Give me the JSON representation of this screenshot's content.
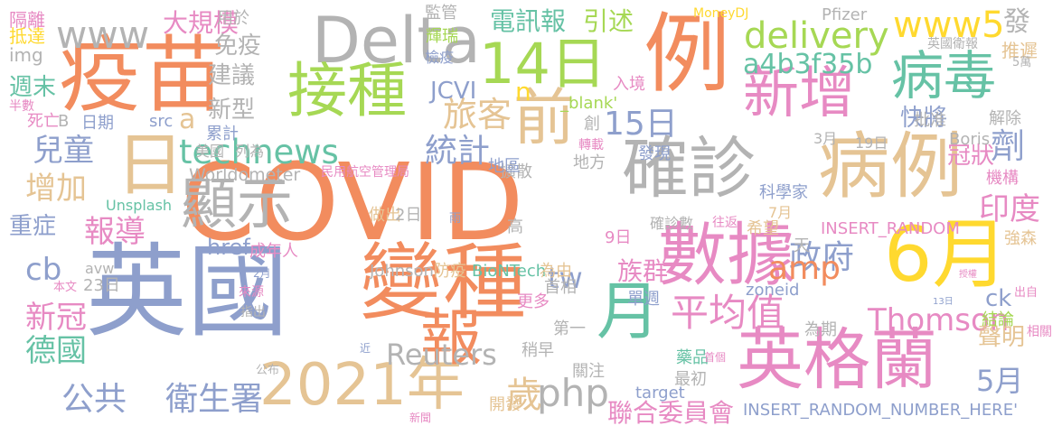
{
  "words": [
    {
      "text": "COVID",
      "color": "#f28c5e"
    },
    {
      "text": "英國",
      "color": "#8e9fcc"
    },
    {
      "text": "疫苗",
      "color": "#f28c5e"
    },
    {
      "text": "例",
      "color": "#f28c5e"
    },
    {
      "text": "變種",
      "color": "#f28c5e"
    },
    {
      "text": "英格蘭",
      "color": "#e78ac3"
    },
    {
      "text": "2021年",
      "color": "#e5c494"
    },
    {
      "text": "數據",
      "color": "#e78ac3"
    },
    {
      "text": "6月",
      "color": "#ffd92f"
    },
    {
      "text": "病例",
      "color": "#e5c494"
    },
    {
      "text": "確診",
      "color": "#b3b3b3"
    },
    {
      "text": "Delta",
      "color": "#b3b3b3"
    },
    {
      "text": "接種",
      "color": "#a6d854"
    },
    {
      "text": "14日",
      "color": "#a6d854"
    },
    {
      "text": "日",
      "color": "#e5c494"
    },
    {
      "text": "顯示",
      "color": "#b3b3b3"
    },
    {
      "text": "新增",
      "color": "#e78ac3"
    },
    {
      "text": "病毒",
      "color": "#66c2a5"
    },
    {
      "text": "前",
      "color": "#e5c494"
    },
    {
      "text": "月",
      "color": "#66c2a5"
    },
    {
      "text": "報",
      "color": "#f28c5e"
    },
    {
      "text": "www",
      "color": "#b3b3b3"
    },
    {
      "text": "www5",
      "color": "#ffd92f"
    },
    {
      "text": "delivery",
      "color": "#a6d854"
    },
    {
      "text": "technews",
      "color": "#66c2a5"
    },
    {
      "text": "公共",
      "color": "#8e9fcc"
    },
    {
      "text": "衛生署",
      "color": "#8e9fcc"
    },
    {
      "text": "php",
      "color": "#b3b3b3"
    },
    {
      "text": "平均值",
      "color": "#e78ac3"
    },
    {
      "text": "政府",
      "color": "#8e9fcc"
    },
    {
      "text": "Thomson",
      "color": "#e78ac3"
    },
    {
      "text": "amp",
      "color": "#f28c5e"
    },
    {
      "text": "Reuters",
      "color": "#b3b3b3"
    },
    {
      "text": "旅客",
      "color": "#e5c494"
    },
    {
      "text": "統計",
      "color": "#8e9fcc"
    },
    {
      "text": "15日",
      "color": "#8e9fcc"
    },
    {
      "text": "兒童",
      "color": "#8e9fcc"
    },
    {
      "text": "增加",
      "color": "#e5c494"
    },
    {
      "text": "報導",
      "color": "#e78ac3"
    },
    {
      "text": "新冠",
      "color": "#e78ac3"
    },
    {
      "text": "德國",
      "color": "#66c2a5"
    },
    {
      "text": "cb",
      "color": "#8e9fcc"
    },
    {
      "text": "印度",
      "color": "#e78ac3"
    },
    {
      "text": "劑",
      "color": "#8e9fcc"
    },
    {
      "text": "5月",
      "color": "#8e9fcc"
    },
    {
      "text": "tw",
      "color": "#8e9fcc"
    },
    {
      "text": "歲",
      "color": "#e5c494"
    },
    {
      "text": "a4b3f35b",
      "color": "#66c2a5"
    },
    {
      "text": "電訊報",
      "color": "#66c2a5"
    },
    {
      "text": "引述",
      "color": "#a6d854"
    },
    {
      "text": "大規模",
      "color": "#e78ac3"
    },
    {
      "text": "免疫",
      "color": "#b3b3b3"
    },
    {
      "text": "建議",
      "color": "#b3b3b3"
    },
    {
      "text": "新型",
      "color": "#b3b3b3"
    },
    {
      "text": "週末",
      "color": "#66c2a5"
    },
    {
      "text": "JCVI",
      "color": "#8e9fcc"
    },
    {
      "text": "族群",
      "color": "#e78ac3"
    },
    {
      "text": "ck",
      "color": "#8e9fcc"
    },
    {
      "text": "聯合委員會",
      "color": "#e78ac3"
    },
    {
      "text": "重症",
      "color": "#8e9fcc"
    },
    {
      "text": "href",
      "color": "#8e9fcc"
    },
    {
      "text": "發",
      "color": "#b3b3b3"
    },
    {
      "text": "快將",
      "color": "#8e9fcc"
    },
    {
      "text": "冠狀",
      "color": "#e78ac3"
    },
    {
      "text": "聲明",
      "color": "#e5c494"
    },
    {
      "text": "a",
      "color": "#e5c494"
    },
    {
      "text": "n",
      "color": "#ffd92f"
    },
    {
      "text": "隔離",
      "color": "#e78ac3"
    },
    {
      "text": "抵達",
      "color": "#ffd92f"
    },
    {
      "text": "img",
      "color": "#b3b3b3"
    },
    {
      "text": "用於",
      "color": "#b3b3b3"
    },
    {
      "text": "監管",
      "color": "#b3b3b3"
    },
    {
      "text": "輝瑞",
      "color": "#a6d854"
    },
    {
      "text": "檢疫",
      "color": "#8e9fcc"
    },
    {
      "text": "MoneyDJ",
      "color": "#ffd92f"
    },
    {
      "text": "Pfizer",
      "color": "#b3b3b3"
    },
    {
      "text": "英國衛報",
      "color": "#b3b3b3"
    },
    {
      "text": "推遲",
      "color": "#e5c494"
    },
    {
      "text": "5萬",
      "color": "#b3b3b3"
    },
    {
      "text": "死亡",
      "color": "#e78ac3"
    },
    {
      "text": "B",
      "color": "#b3b3b3"
    },
    {
      "text": "半數",
      "color": "#e78ac3"
    },
    {
      "text": "日期",
      "color": "#8e9fcc"
    },
    {
      "text": "src",
      "color": "#8e9fcc"
    },
    {
      "text": "_blank'",
      "color": "#a6d854"
    },
    {
      "text": "入境",
      "color": "#e78ac3"
    },
    {
      "text": "創",
      "color": "#b3b3b3"
    },
    {
      "text": "批准",
      "color": "#b3b3b3"
    },
    {
      "text": "解除",
      "color": "#b3b3b3"
    },
    {
      "text": "累計",
      "color": "#8e9fcc"
    },
    {
      "text": "擴散",
      "color": "#b3b3b3"
    },
    {
      "text": "轉載",
      "color": "#e78ac3"
    },
    {
      "text": "列為",
      "color": "#b3b3b3"
    },
    {
      "text": "3月",
      "color": "#b3b3b3"
    },
    {
      "text": "19日",
      "color": "#b3b3b3"
    },
    {
      "text": "美國",
      "color": "#b3b3b3"
    },
    {
      "text": "發現",
      "color": "#8e9fcc"
    },
    {
      "text": "Boris",
      "color": "#b3b3b3"
    },
    {
      "text": "Worldometer",
      "color": "#b3b3b3"
    },
    {
      "text": "民用航空管理局",
      "color": "#e78ac3"
    },
    {
      "text": "地區",
      "color": "#8e9fcc"
    },
    {
      "text": "地方",
      "color": "#b3b3b3"
    },
    {
      "text": "機構",
      "color": "#e78ac3"
    },
    {
      "text": "科學家",
      "color": "#8e9fcc"
    },
    {
      "text": "7月",
      "color": "#e5c494"
    },
    {
      "text": "Unsplash",
      "color": "#66c2a5"
    },
    {
      "text": "希望",
      "color": "#e5c494"
    },
    {
      "text": "做出",
      "color": "#e5c494"
    },
    {
      "text": "2日",
      "color": "#b3b3b3"
    },
    {
      "text": "雨",
      "color": "#8e9fcc"
    },
    {
      "text": "高",
      "color": "#b3b3b3"
    },
    {
      "text": "確診數",
      "color": "#b3b3b3"
    },
    {
      "text": "INSERT_RANDOM",
      "color": "#e78ac3"
    },
    {
      "text": "往返",
      "color": "#e78ac3"
    },
    {
      "text": "9日",
      "color": "#e78ac3"
    },
    {
      "text": "天",
      "color": "#b3b3b3"
    },
    {
      "text": "強森",
      "color": "#e5c494"
    },
    {
      "text": "成年人",
      "color": "#e78ac3"
    },
    {
      "text": "avw",
      "color": "#b3b3b3"
    },
    {
      "text": "Johnson",
      "color": "#b3b3b3"
    },
    {
      "text": "防疫",
      "color": "#e5c494"
    },
    {
      "text": "BioNTech",
      "color": "#66c2a5"
    },
    {
      "text": "為由",
      "color": "#e5c494"
    },
    {
      "text": "首相",
      "color": "#b3b3b3"
    },
    {
      "text": "單週",
      "color": "#8e9fcc"
    },
    {
      "text": "zoneid",
      "color": "#8e9fcc"
    },
    {
      "text": "授權",
      "color": "#e78ac3"
    },
    {
      "text": "出自",
      "color": "#e78ac3"
    },
    {
      "text": "本文",
      "color": "#e78ac3"
    },
    {
      "text": "23日",
      "color": "#b3b3b3"
    },
    {
      "text": "2月",
      "color": "#8e9fcc"
    },
    {
      "text": "來源",
      "color": "#e78ac3"
    },
    {
      "text": "指出",
      "color": "#b3b3b3"
    },
    {
      "text": "更多",
      "color": "#e78ac3"
    },
    {
      "text": "第一",
      "color": "#b3b3b3"
    },
    {
      "text": "為期",
      "color": "#b3b3b3"
    },
    {
      "text": "13日",
      "color": "#8e9fcc"
    },
    {
      "text": "結論",
      "color": "#a6d854"
    },
    {
      "text": "相關",
      "color": "#e78ac3"
    },
    {
      "text": "近",
      "color": "#8e9fcc"
    },
    {
      "text": "稍早",
      "color": "#b3b3b3"
    },
    {
      "text": "藥品",
      "color": "#66c2a5"
    },
    {
      "text": "首個",
      "color": "#e78ac3"
    },
    {
      "text": "公布",
      "color": "#b3b3b3"
    },
    {
      "text": "關注",
      "color": "#b3b3b3"
    },
    {
      "text": "最初",
      "color": "#b3b3b3"
    },
    {
      "text": "target",
      "color": "#8e9fcc"
    },
    {
      "text": "開發",
      "color": "#e5c494"
    },
    {
      "text": "新聞",
      "color": "#e78ac3"
    },
    {
      "text": "INSERT_RANDOM_NUMBER_HERE'",
      "color": "#8e9fcc"
    }
  ]
}
